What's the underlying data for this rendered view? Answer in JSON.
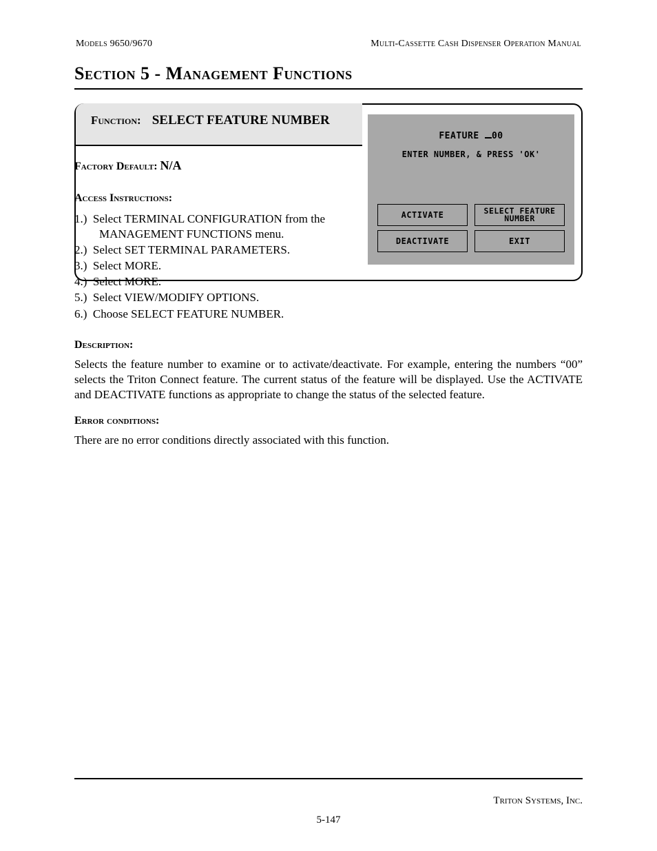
{
  "header": {
    "left": "Models 9650/9670",
    "right": "Multi-Cassette Cash Dispenser Operation Manual"
  },
  "section_title": "Section 5 - Management Functions",
  "function_box": {
    "label": "Function:",
    "name": "SELECT FEATURE NUMBER",
    "factory_default_label": "Factory Default:",
    "factory_default_value": "N/A",
    "access_instructions_label": "Access Instructions:",
    "steps": [
      {
        "num": "1.)",
        "text": "Select TERMINAL CONFIGURATION from the MANAGEMENT FUNCTIONS menu."
      },
      {
        "num": "2.)",
        "text": "Select SET TERMINAL PARAMETERS."
      },
      {
        "num": "3.)",
        "text": "Select MORE."
      },
      {
        "num": "4.)",
        "text": "Select MORE."
      },
      {
        "num": "5.)",
        "text": "Select VIEW/MODIFY OPTIONS."
      },
      {
        "num": "6.)",
        "text": "Choose SELECT FEATURE NUMBER."
      }
    ]
  },
  "terminal": {
    "line1_prefix": "FEATURE ",
    "line1_value": "00",
    "line2": "ENTER NUMBER, & PRESS 'OK'",
    "buttons": [
      "ACTIVATE",
      "SELECT FEATURE NUMBER",
      "DEACTIVATE",
      "EXIT"
    ]
  },
  "description": {
    "label": "Description:",
    "text": "Selects the feature number to examine or to activate/deactivate.  For example, entering the numbers “00” selects the Triton Connect feature. The current status of the feature will be displayed. Use the ACTIVATE and DEACTIVATE functions as appropriate to change the status of the selected feature."
  },
  "error_conditions": {
    "label": "Error conditions:",
    "text": "There are no error conditions directly associated with this function."
  },
  "footer": {
    "company": "Triton Systems, Inc.",
    "page": "5-147"
  }
}
